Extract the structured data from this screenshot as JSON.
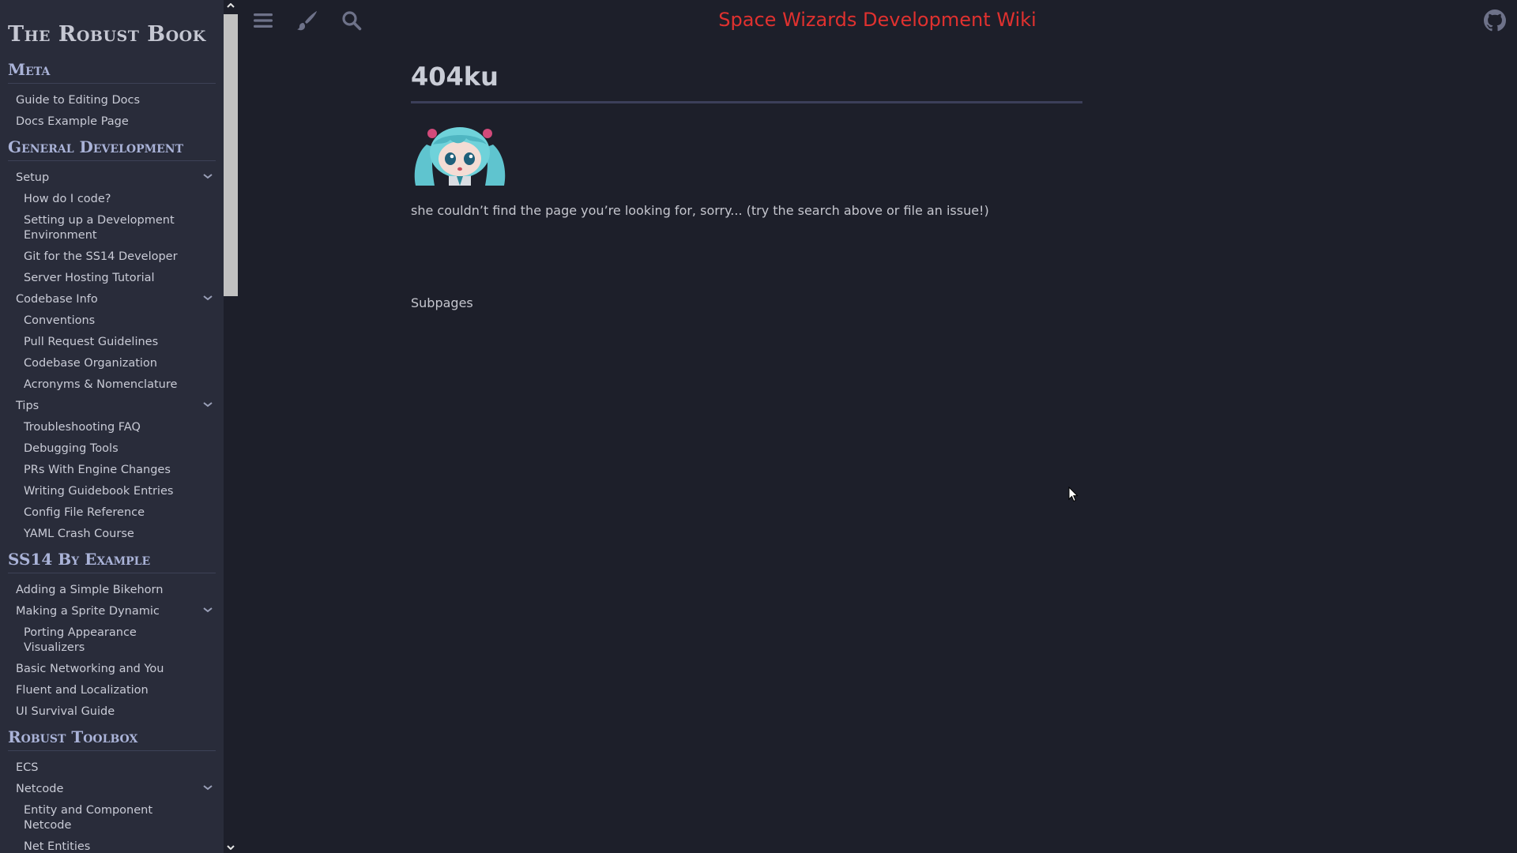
{
  "sidebar": {
    "book_title": "The Robust Book",
    "sections": [
      {
        "title": "Meta",
        "items": [
          {
            "label": "Guide to Editing Docs",
            "level": 1,
            "expandable": false
          },
          {
            "label": "Docs Example Page",
            "level": 1,
            "expandable": false
          }
        ]
      },
      {
        "title": "General Development",
        "items": [
          {
            "label": "Setup",
            "level": 1,
            "expandable": true
          },
          {
            "label": "How do I code?",
            "level": 2,
            "expandable": false
          },
          {
            "label": "Setting up a Development Environment",
            "level": 2,
            "expandable": false
          },
          {
            "label": "Git for the SS14 Developer",
            "level": 2,
            "expandable": false
          },
          {
            "label": "Server Hosting Tutorial",
            "level": 2,
            "expandable": false
          },
          {
            "label": "Codebase Info",
            "level": 1,
            "expandable": true
          },
          {
            "label": "Conventions",
            "level": 2,
            "expandable": false
          },
          {
            "label": "Pull Request Guidelines",
            "level": 2,
            "expandable": false
          },
          {
            "label": "Codebase Organization",
            "level": 2,
            "expandable": false
          },
          {
            "label": "Acronyms & Nomenclature",
            "level": 2,
            "expandable": false
          },
          {
            "label": "Tips",
            "level": 1,
            "expandable": true
          },
          {
            "label": "Troubleshooting FAQ",
            "level": 2,
            "expandable": false
          },
          {
            "label": "Debugging Tools",
            "level": 2,
            "expandable": false
          },
          {
            "label": "PRs With Engine Changes",
            "level": 2,
            "expandable": false
          },
          {
            "label": "Writing Guidebook Entries",
            "level": 2,
            "expandable": false
          },
          {
            "label": "Config File Reference",
            "level": 2,
            "expandable": false
          },
          {
            "label": "YAML Crash Course",
            "level": 2,
            "expandable": false
          }
        ]
      },
      {
        "title": "SS14 By Example",
        "items": [
          {
            "label": "Adding a Simple Bikehorn",
            "level": 1,
            "expandable": false
          },
          {
            "label": "Making a Sprite Dynamic",
            "level": 1,
            "expandable": true
          },
          {
            "label": "Porting Appearance Visualizers",
            "level": 2,
            "expandable": false
          },
          {
            "label": "Basic Networking and You",
            "level": 1,
            "expandable": false
          },
          {
            "label": "Fluent and Localization",
            "level": 1,
            "expandable": false
          },
          {
            "label": "UI Survival Guide",
            "level": 1,
            "expandable": false
          }
        ]
      },
      {
        "title": "Robust Toolbox",
        "items": [
          {
            "label": "ECS",
            "level": 1,
            "expandable": false
          },
          {
            "label": "Netcode",
            "level": 1,
            "expandable": true
          },
          {
            "label": "Entity and Component Netcode",
            "level": 2,
            "expandable": false
          },
          {
            "label": "Net Entities",
            "level": 2,
            "expandable": false
          }
        ]
      }
    ]
  },
  "topbar": {
    "menu_icon": "hamburger-menu-icon",
    "theme_icon": "paintbrush-icon",
    "search_icon": "search-icon",
    "site_title": "Space Wizards Development Wiki",
    "github_icon": "github-icon"
  },
  "content": {
    "page_title": "404ku",
    "message": "she couldn’t find the page you’re looking for, sorry... (try the search above or file an issue!)",
    "subpages_label": "Subpages"
  },
  "colors": {
    "background": "#1d1f2a",
    "sidebar_bg": "#292c3a",
    "site_title": "#e0312f",
    "section_heading": "#aab3d8"
  }
}
